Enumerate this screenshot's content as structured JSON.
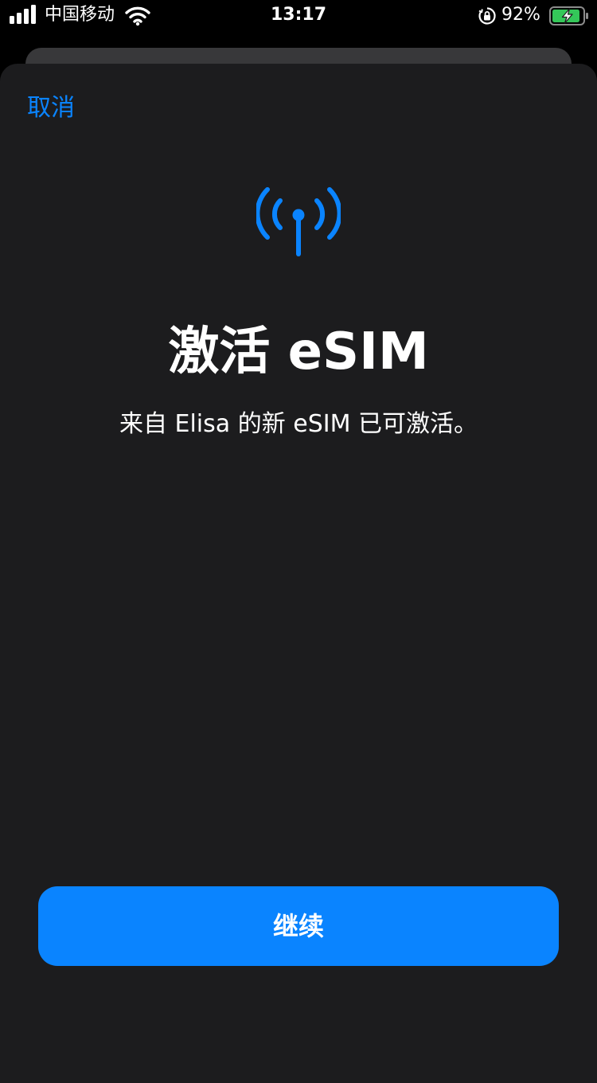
{
  "status_bar": {
    "carrier": "中国移动",
    "time": "13:17",
    "battery_percent": "92%",
    "battery_level": 0.92,
    "charging": true,
    "icons": [
      "signal-bars-icon",
      "wifi-icon",
      "orientation-lock-icon",
      "battery-charging-icon"
    ]
  },
  "nav": {
    "cancel_label": "取消"
  },
  "main": {
    "icon": "antenna-radiowaves-icon",
    "title": "激活 eSIM",
    "description": "来自 Elisa 的新 eSIM 已可激活。"
  },
  "footer": {
    "continue_label": "继续"
  },
  "colors": {
    "accent": "#0a84ff",
    "background": "#000000",
    "sheet": "#1c1c1e",
    "sheet_behind": "#38383a",
    "text": "#ffffff",
    "battery_fill": "#34c759"
  }
}
